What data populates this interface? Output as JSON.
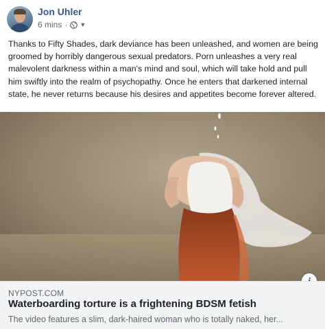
{
  "post": {
    "author": "Jon Uhler",
    "time": "6 mins",
    "separator": "·",
    "privacy_icon": "globe-icon",
    "menu_icon": "caret-down-icon",
    "text": "Thanks to Fifty Shades, dark deviance has been unleashed, and women are being groomed by horribly dangerous sexual predators. Porn unleashes a very real malevolent darkness within a man's mind and soul, which will take hold and pull him swiftly into the realm of psychopathy. Once he enters that darkened internal state, he never returns because his desires and appetites become forever altered."
  },
  "link": {
    "domain": "NYPOST.COM",
    "title": "Waterboarding torture is a frightening BDSM fetish",
    "description": "The video features a slim, dark-haired woman who is totally naked, her...",
    "info_icon": "info-icon",
    "info_glyph": "i"
  },
  "colors": {
    "author_link": "#385898",
    "link_box_bg": "#f2f3f5",
    "secondary_text": "#606770"
  }
}
